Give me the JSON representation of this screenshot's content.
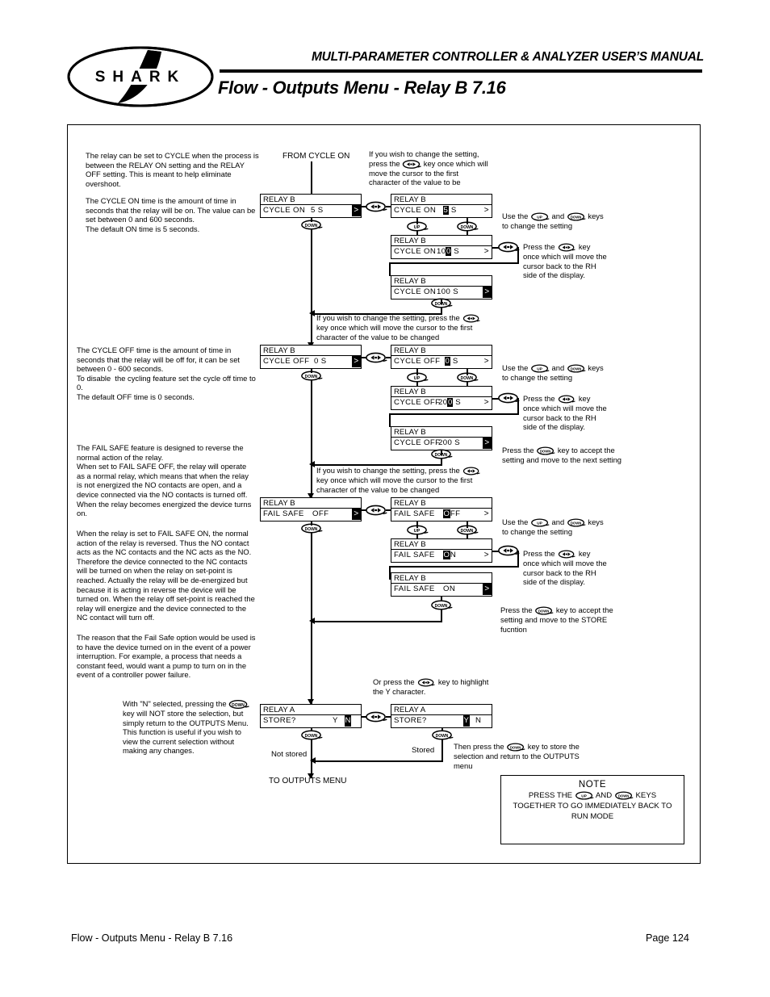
{
  "header": {
    "manual_title": "MULTI-PARAMETER CONTROLLER & ANALYZER USER’S MANUAL",
    "page_subtitle": "Flow - Outputs Menu - Relay B 7.16",
    "logo_text": "SHARK"
  },
  "footer": {
    "left": "Flow - Outputs Menu - Relay B 7.16",
    "right": "Page 124"
  },
  "left_column": {
    "p1": "The relay can be set to CYCLE when the process is between the RELAY ON setting and the RELAY OFF setting. This is meant to help eliminate overshoot.",
    "p2": "The CYCLE ON time is the amount of time in seconds that the relay will be on. The value can be set between 0 and 600 seconds.\nThe default ON time is 5 seconds.",
    "p3": "The CYCLE OFF time is the amount of time in seconds that the relay will be off for, it can be set between 0 - 600 seconds.\nTo disable  the cycling feature set the cycle off time to 0.\nThe default OFF time is 0 seconds.",
    "p4": "The FAIL SAFE feature is designed to reverse the normal action of the relay.\nWhen set to FAIL SAFE OFF, the relay will operate as a normal relay, which means that when the relay is not energized the NO contacts are open, and a device connected via the NO contacts is turned off. When the relay becomes energized the device turns on.",
    "p5": "When the relay is set to FAIL SAFE ON, the normal action of the relay is reversed. Thus the NO contact acts as the NC contacts and the NC acts as the NO. Therefore the device connected to the NC contacts will be turned on when the relay on set-point is reached. Actually the relay will be de-energized but because it is acting in reverse the device will be turned on. When the relay off set-point is reached the relay will energize and the device connected to the NC contact will turn off.",
    "p6": "The reason that the Fail Safe option would be used is to have the device turned on in the event of a power interruption. For example, a process that needs a constant feed, would want a pump to turn on in the event of a controller power failure.",
    "p7_a": "With \"N\" selected, pressing the",
    "p7_b": "key will NOT store the selection, but simply return to the OUTPUTS Menu. This function is useful if you wish to view the current selection without making any changes."
  },
  "flow": {
    "from_label": "FROM CYCLE ON",
    "to_label": "TO OUTPUTS MENU",
    "not_stored": "Not stored",
    "stored": "Stored"
  },
  "instructions": {
    "change_setting_top_a": "If you wish to change the setting, press the",
    "change_setting_top_b": "key once which will move the cursor to the first character of the value to be",
    "change_setting_a": "If you wish to change the setting, press the",
    "change_setting_b": "key once which will move the cursor to the first character of the value to be changed",
    "use_updown_a": "Use the",
    "use_updown_and": "and",
    "use_updown_b": "keys to change the setting",
    "press_lr_a": "Press the",
    "press_lr_b": "key once which will move the cursor back to the RH side of the display.",
    "accept_next_a": "Press the",
    "accept_next_b": "key to accept the setting and move to the next setting",
    "accept_store_a": "Press the",
    "accept_store_b": "key to accept the setting and move to the STORE fucntion",
    "or_press_a": "Or press the",
    "or_press_b": "key to highlight the Y character.",
    "then_press_a": "Then press the",
    "then_press_b": "key to store the selection and return to the OUTPUTS menu"
  },
  "note": {
    "title": "NOTE",
    "line1_a": "PRESS THE",
    "line1_and": "AND",
    "line1_b": "KEYS",
    "line2": "TOGETHER TO GO IMMEDIATELY BACK TO",
    "line3": "RUN MODE"
  },
  "keys": {
    "up": "UP",
    "down": "DOWN",
    "leftright": "◄►"
  },
  "screens": {
    "cycle_on_1": {
      "title": "RELAY B",
      "label": "CYCLE   ON",
      "value": "5 S",
      "cursor": "right"
    },
    "cycle_on_2": {
      "title": "RELAY B",
      "label": "CYCLE   ON",
      "pre": "",
      "hl": "5",
      "post": " S",
      "cursor": "none"
    },
    "cycle_on_3": {
      "title": "RELAY B",
      "label": "CYCLE   ON",
      "pre": "10",
      "hl": "0",
      "post": " S",
      "cursor": "none"
    },
    "cycle_on_4": {
      "title": "RELAY B",
      "label": "CYCLE   ON",
      "value": "100 S",
      "cursor": "right"
    },
    "cycle_off_1": {
      "title": "RELAY B",
      "label": "CYCLE   OFF",
      "value": "0 S",
      "cursor": "right"
    },
    "cycle_off_2": {
      "title": "RELAY B",
      "label": "CYCLE   OFF",
      "pre": "",
      "hl": "0",
      "post": " S",
      "cursor": "none"
    },
    "cycle_off_3": {
      "title": "RELAY B",
      "label": "CYCLE   OFF",
      "pre": "20",
      "hl": "0",
      "post": " S",
      "cursor": "none"
    },
    "cycle_off_4": {
      "title": "RELAY B",
      "label": "CYCLE   OFF",
      "value": "200 S",
      "cursor": "right"
    },
    "failsafe_1": {
      "title": "RELAY B",
      "label": "FAIL   SAFE",
      "value": "OFF",
      "cursor": "right"
    },
    "failsafe_2": {
      "title": "RELAY B",
      "label": "FAIL   SAFE",
      "pre": "",
      "hl": "O",
      "post": "FF",
      "cursor": "none"
    },
    "failsafe_3": {
      "title": "RELAY B",
      "label": "FAIL   SAFE",
      "pre": "",
      "hl": "O",
      "post": "N",
      "cursor": "none"
    },
    "failsafe_4": {
      "title": "RELAY B",
      "label": "FAIL   SAFE",
      "value": "ON",
      "cursor": "right"
    },
    "store_n": {
      "title": "RELAY A",
      "label": "STORE?",
      "yes": "Y",
      "no": "N",
      "highlight": "N"
    },
    "store_y": {
      "title": "RELAY A",
      "label": "STORE?",
      "yes": "Y",
      "no": "N",
      "highlight": "Y"
    }
  }
}
